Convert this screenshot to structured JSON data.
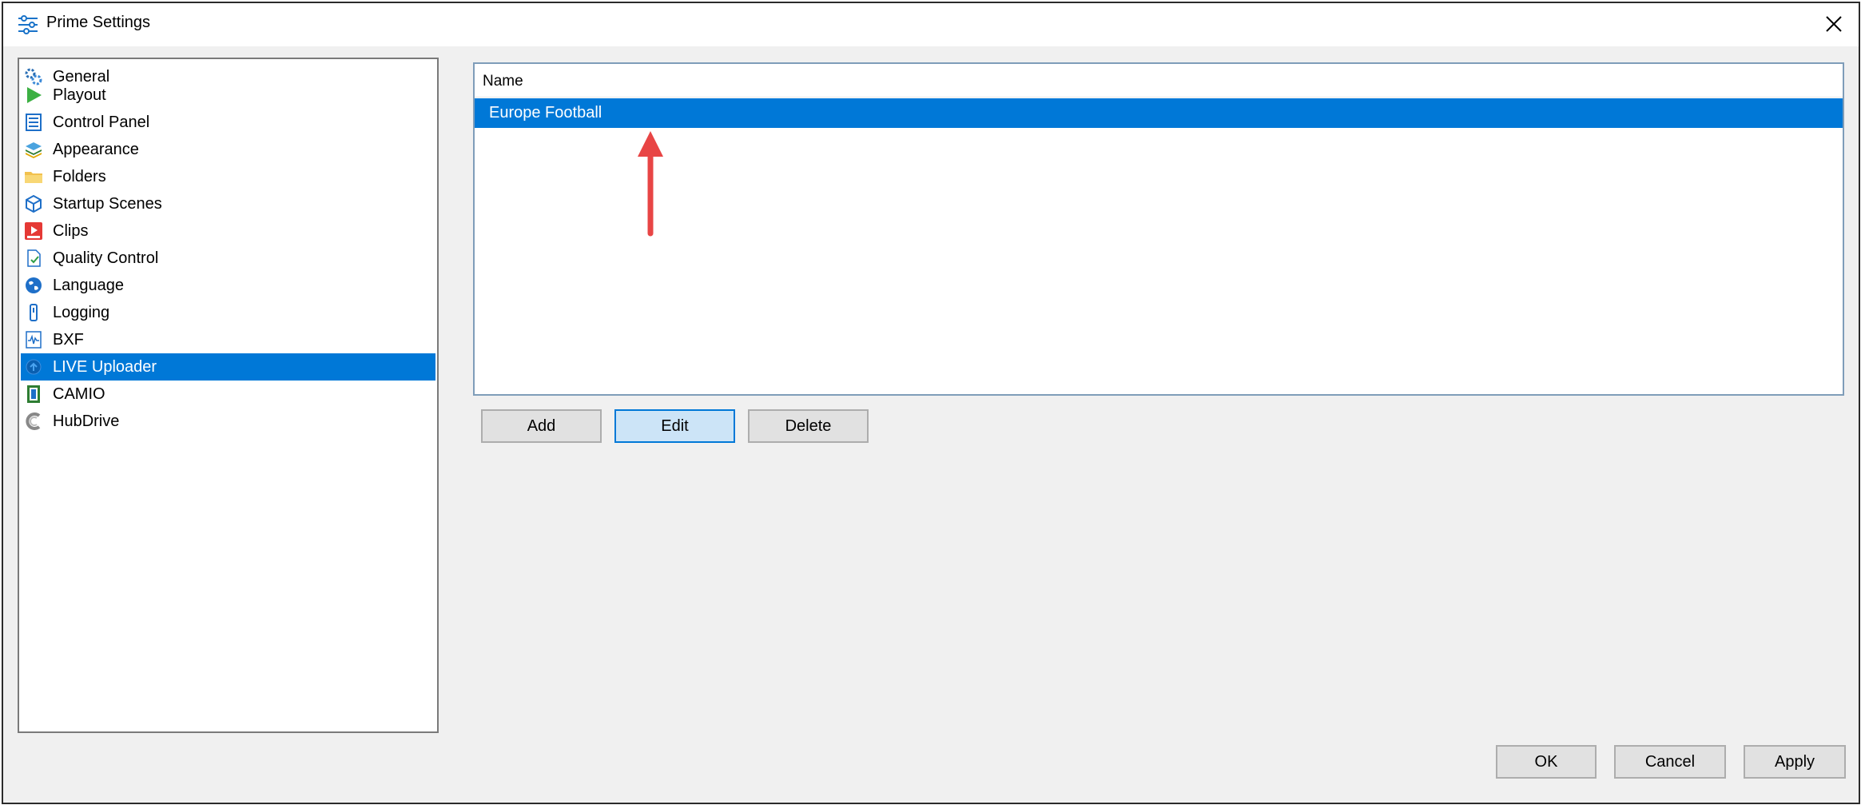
{
  "window": {
    "title": "Prime Settings"
  },
  "sidebar": {
    "items": [
      {
        "label": "General",
        "icon": "general-gear-icon"
      },
      {
        "label": "Playout",
        "icon": "play-icon"
      },
      {
        "label": "Control Panel",
        "icon": "control-panel-icon"
      },
      {
        "label": "Appearance",
        "icon": "layers-icon"
      },
      {
        "label": "Folders",
        "icon": "folder-icon"
      },
      {
        "label": "Startup Scenes",
        "icon": "cube-icon"
      },
      {
        "label": "Clips",
        "icon": "clip-icon"
      },
      {
        "label": "Quality Control",
        "icon": "document-check-icon"
      },
      {
        "label": "Language",
        "icon": "globe-icon"
      },
      {
        "label": "Logging",
        "icon": "logging-icon"
      },
      {
        "label": "BXF",
        "icon": "waveform-doc-icon"
      },
      {
        "label": "LIVE Uploader",
        "icon": "uploader-icon",
        "selected": true
      },
      {
        "label": "CAMIO",
        "icon": "camio-icon"
      },
      {
        "label": "HubDrive",
        "icon": "hubdrive-icon"
      }
    ]
  },
  "list": {
    "header": "Name",
    "rows": [
      {
        "name": "Europe Football",
        "selected": true
      }
    ]
  },
  "actions": {
    "add": "Add",
    "edit": "Edit",
    "delete": "Delete"
  },
  "footer": {
    "ok": "OK",
    "cancel": "Cancel",
    "apply": "Apply"
  },
  "colors": {
    "selection": "#0078d7",
    "annotation_arrow": "#e84545"
  }
}
